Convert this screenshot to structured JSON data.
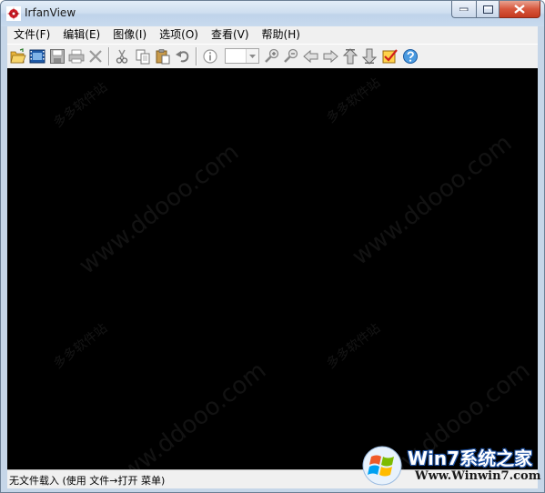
{
  "window": {
    "title": "IrfanView"
  },
  "menu": [
    {
      "label": "文件(F)"
    },
    {
      "label": "编辑(E)"
    },
    {
      "label": "图像(I)"
    },
    {
      "label": "选项(O)"
    },
    {
      "label": "查看(V)"
    },
    {
      "label": "帮助(H)"
    }
  ],
  "toolbar": {
    "icons": [
      "open-folder-icon",
      "slideshow-icon",
      "save-icon",
      "print-icon",
      "delete-icon",
      "cut-icon",
      "copy-icon",
      "paste-icon",
      "undo-icon",
      "info-icon",
      "zoom-in-icon",
      "zoom-out-icon",
      "previous-icon",
      "next-icon",
      "first-file-icon",
      "last-file-icon",
      "options-icon",
      "help-icon"
    ],
    "zoom_value": ""
  },
  "status": {
    "text": "无文件载入 (使用 文件→打开 菜单)"
  },
  "watermarks": {
    "url": "www.ddooo.com",
    "cn": "多多软件站"
  },
  "logo": {
    "title": "Win7系统之家",
    "url": "Www.Winwin7.com"
  },
  "colors": {
    "viewer_bg": "#000000",
    "chrome": "#f0f0f0",
    "frame": "#c6d6e8"
  }
}
